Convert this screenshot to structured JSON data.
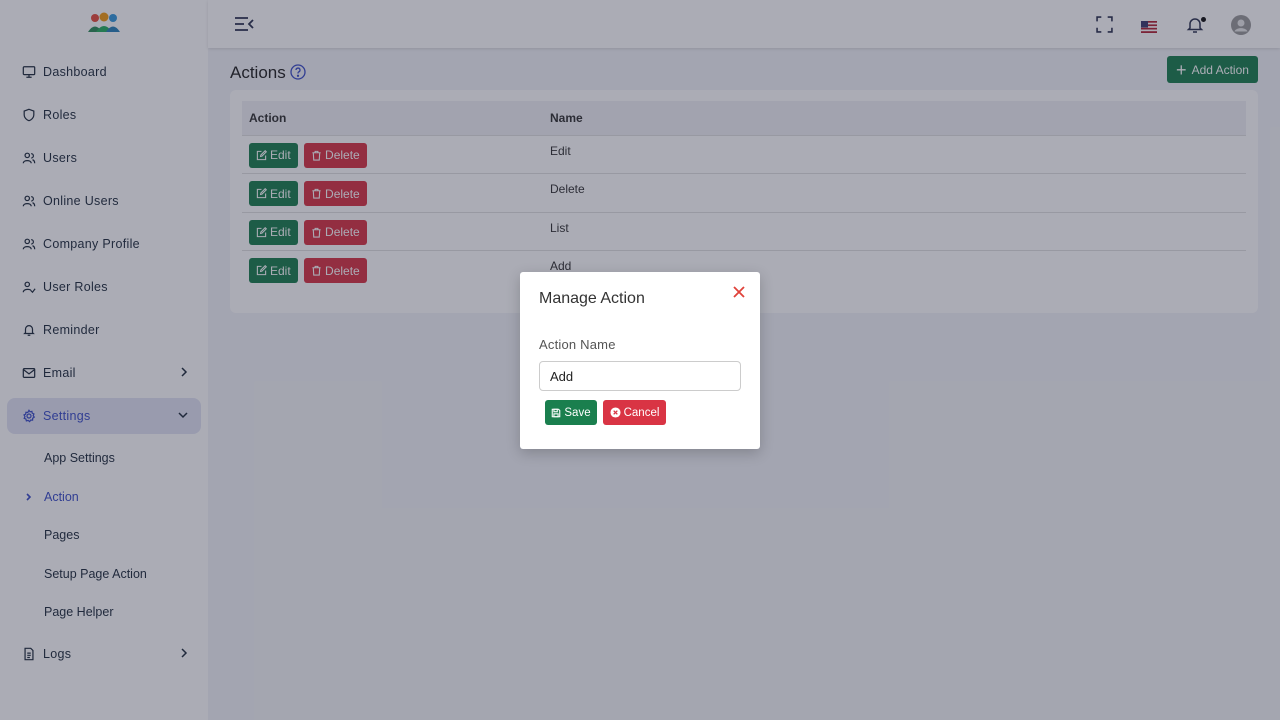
{
  "sidebar": {
    "items": [
      {
        "label": "Dashboard",
        "icon": "monitor-icon"
      },
      {
        "label": "Roles",
        "icon": "shield-icon"
      },
      {
        "label": "Users",
        "icon": "users-icon"
      },
      {
        "label": "Online Users",
        "icon": "users-icon"
      },
      {
        "label": "Company Profile",
        "icon": "users-icon"
      },
      {
        "label": "User Roles",
        "icon": "user-check-icon"
      },
      {
        "label": "Reminder",
        "icon": "bell-icon"
      },
      {
        "label": "Email",
        "icon": "mail-icon"
      },
      {
        "label": "Settings",
        "icon": "gear-icon"
      },
      {
        "label": "Logs",
        "icon": "file-icon"
      }
    ],
    "settings_sub": [
      {
        "label": "App Settings"
      },
      {
        "label": "Action"
      },
      {
        "label": "Pages"
      },
      {
        "label": "Setup Page Action"
      },
      {
        "label": "Page Helper"
      }
    ]
  },
  "page": {
    "title": "Actions",
    "add_button": "Add Action"
  },
  "table": {
    "headers": [
      "Action",
      "Name"
    ],
    "edit_label": "Edit",
    "delete_label": "Delete",
    "rows": [
      {
        "name": "Edit"
      },
      {
        "name": "Delete"
      },
      {
        "name": "List"
      },
      {
        "name": "Add"
      }
    ]
  },
  "modal": {
    "title": "Manage Action",
    "field_label": "Action Name",
    "field_value": "Add",
    "save_label": "Save",
    "cancel_label": "Cancel"
  },
  "colors": {
    "accent": "#3b4ec8",
    "success": "#1a7f4e",
    "danger": "#d93444"
  }
}
